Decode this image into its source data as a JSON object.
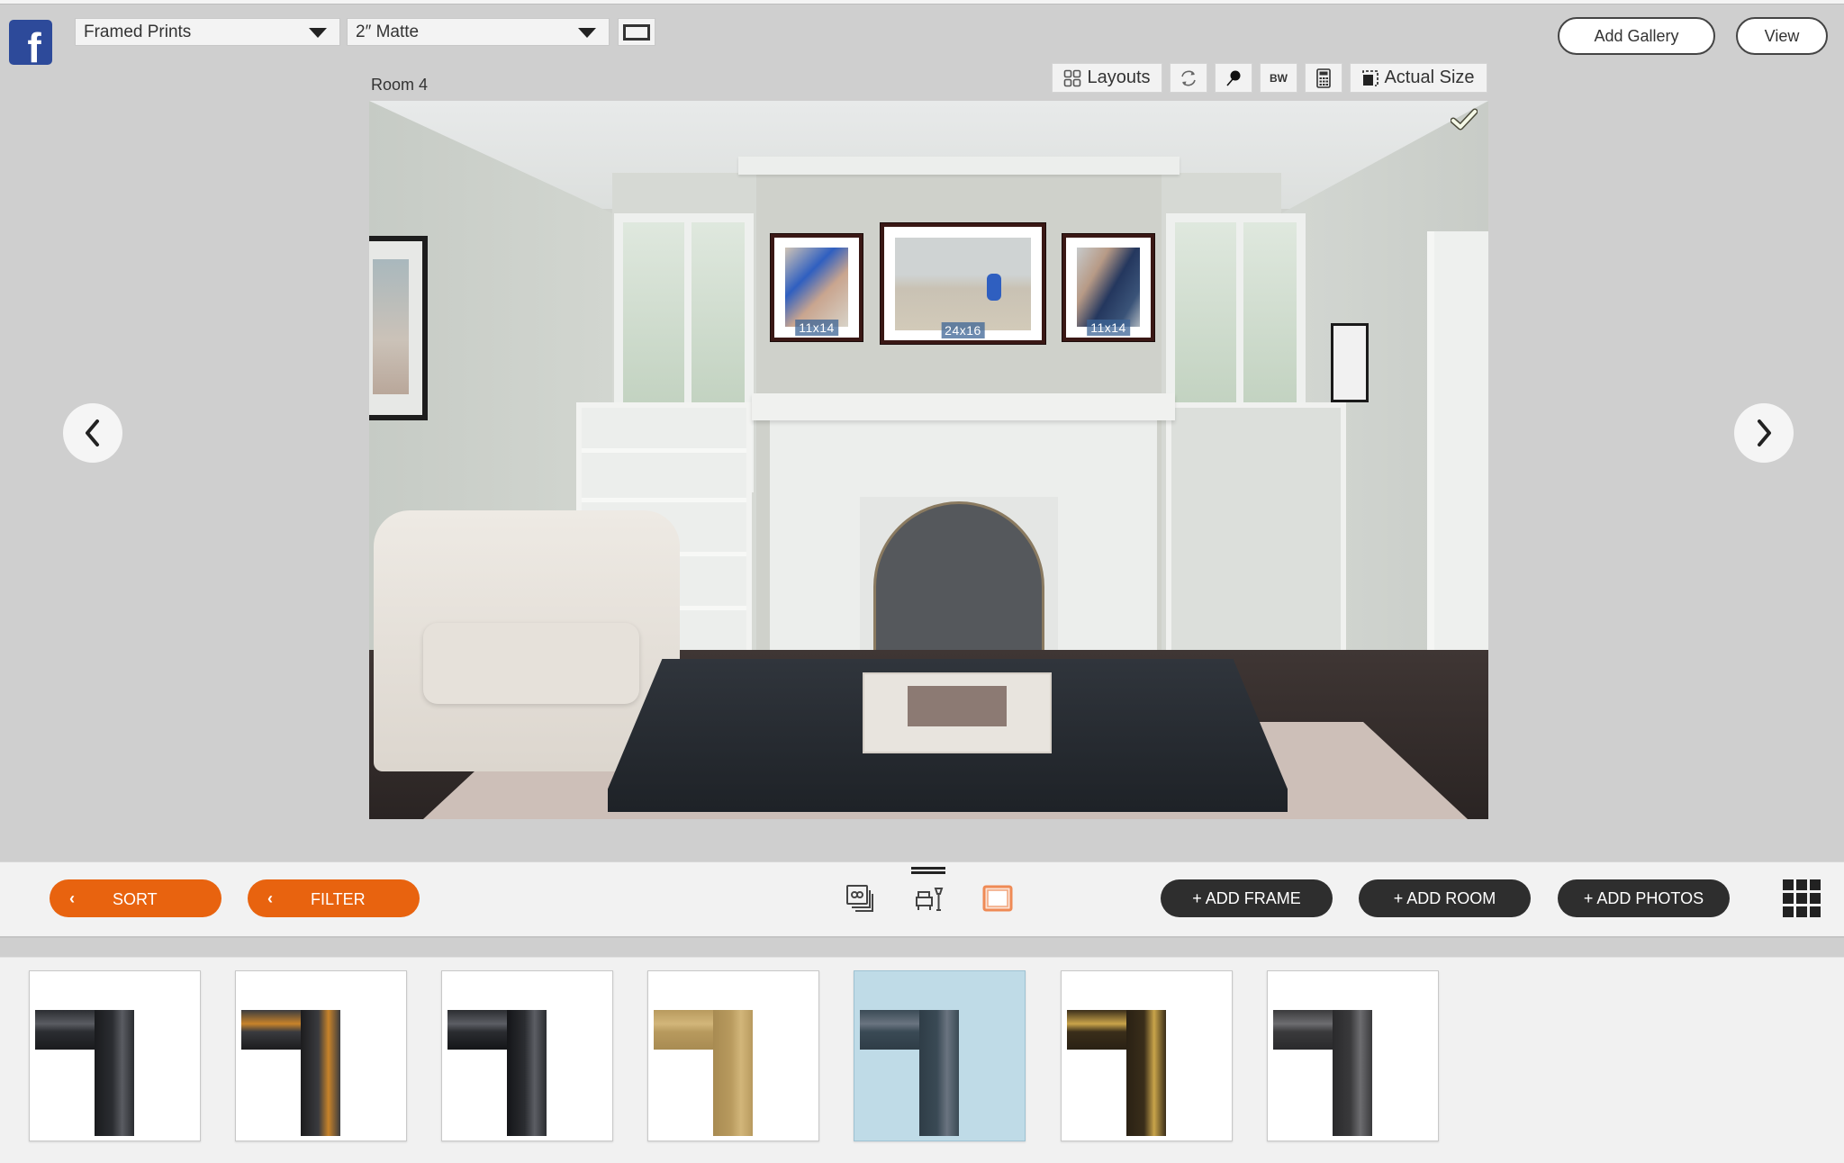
{
  "header": {
    "social_icon": "facebook-icon",
    "product_select": {
      "value": "Framed Prints"
    },
    "matte_select": {
      "value": "2″ Matte"
    },
    "frame_toggle_icon": "rectangle-frame-icon",
    "add_gallery_label": "Add Gallery",
    "view_label": "View"
  },
  "room": {
    "label": "Room 4",
    "selected_check_icon": "checkmark-icon",
    "wall_frames": [
      {
        "size": "11x14"
      },
      {
        "size": "24x16"
      },
      {
        "size": "11x14"
      }
    ]
  },
  "room_tools": {
    "layouts_label": "Layouts",
    "layouts_icon": "grid-layout-icon",
    "rotate_icon": "rotate-icon",
    "pin_icon": "pin-icon",
    "bw_label": "BW",
    "calculator_icon": "calculator-icon",
    "actual_size_label": "Actual Size",
    "actual_size_icon": "actual-size-icon"
  },
  "navigation": {
    "prev_icon": "chevron-left-icon",
    "next_icon": "chevron-right-icon"
  },
  "toolbar": {
    "sort_label": "SORT",
    "filter_label": "FILTER",
    "chevron": "‹",
    "modes": [
      {
        "name": "photos",
        "icon": "photo-stack-icon",
        "active": false
      },
      {
        "name": "room",
        "icon": "room-furniture-icon",
        "active": false
      },
      {
        "name": "frame",
        "icon": "frame-icon",
        "active": true
      }
    ],
    "add_frame_label": "+ ADD FRAME",
    "add_room_label": "+ ADD ROOM",
    "add_photos_label": "+ ADD PHOTOS",
    "grid_view_icon": "grid-view-icon",
    "accent_color": "#e8630f",
    "dark_button_color": "#2e2e2e"
  },
  "frames": {
    "selected_index": 4,
    "items": [
      {
        "style": "black-matte",
        "outer": "#2b2d31",
        "inner": "#1a1b1e",
        "accent": "#5a5c62"
      },
      {
        "style": "black-gold",
        "outer": "#3a3b3f",
        "inner": "#1c1c1e",
        "accent": "#c8832a"
      },
      {
        "style": "black-satin",
        "outer": "#2b2d31",
        "inner": "#141518",
        "accent": "#5c5e64"
      },
      {
        "style": "gold-rope",
        "outer": "#b89a5e",
        "inner": "#a88b52",
        "accent": "#d2b67a"
      },
      {
        "style": "slate-grey",
        "outer": "#3a4a55",
        "inner": "#2f3d47",
        "accent": "#6a7480"
      },
      {
        "style": "antique-gold-ornate",
        "outer": "#3a2e1a",
        "inner": "#2a2114",
        "accent": "#c9a44a"
      },
      {
        "style": "charcoal-rope",
        "outer": "#3a3a3c",
        "inner": "#2a2a2c",
        "accent": "#6d6d70"
      }
    ]
  }
}
